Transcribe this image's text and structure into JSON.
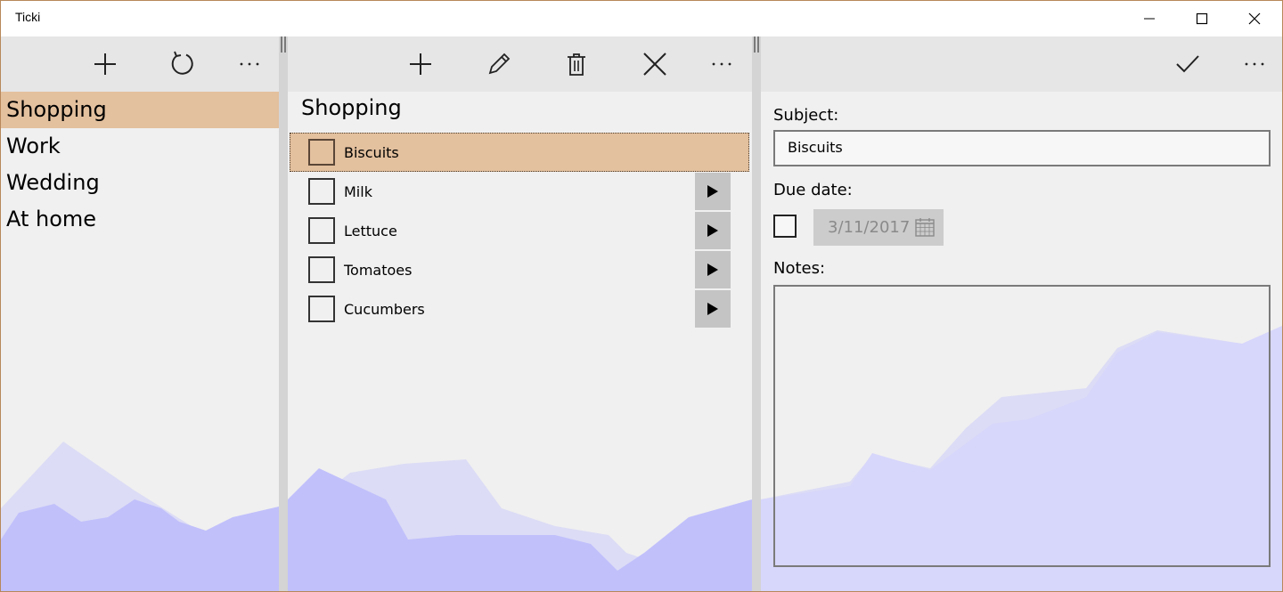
{
  "window": {
    "title": "Ticki"
  },
  "categories": {
    "items": [
      {
        "label": "Shopping",
        "selected": true
      },
      {
        "label": "Work",
        "selected": false
      },
      {
        "label": "Wedding",
        "selected": false
      },
      {
        "label": "At home",
        "selected": false
      }
    ]
  },
  "tasks": {
    "title": "Shopping",
    "items": [
      {
        "label": "Biscuits",
        "selected": true
      },
      {
        "label": "Milk",
        "selected": false
      },
      {
        "label": "Lettuce",
        "selected": false
      },
      {
        "label": "Tomatoes",
        "selected": false
      },
      {
        "label": "Cucumbers",
        "selected": false
      }
    ]
  },
  "details": {
    "subject_label": "Subject:",
    "subject_value": "Biscuits",
    "due_label": "Due date:",
    "due_value": "3/11/2017",
    "notes_label": "Notes:"
  },
  "colors": {
    "accent": "#e3c09e",
    "mountain_dark": "#c1c0fb",
    "mountain_light": "#dcdcf6",
    "frame": "#b7885a"
  },
  "icons": {
    "left_toolbar": [
      "add-icon",
      "refresh-icon",
      "more-icon"
    ],
    "mid_toolbar": [
      "add-icon",
      "edit-icon",
      "delete-icon",
      "close-icon",
      "more-icon"
    ],
    "right_toolbar": [
      "checkmark-icon",
      "more-icon"
    ]
  }
}
